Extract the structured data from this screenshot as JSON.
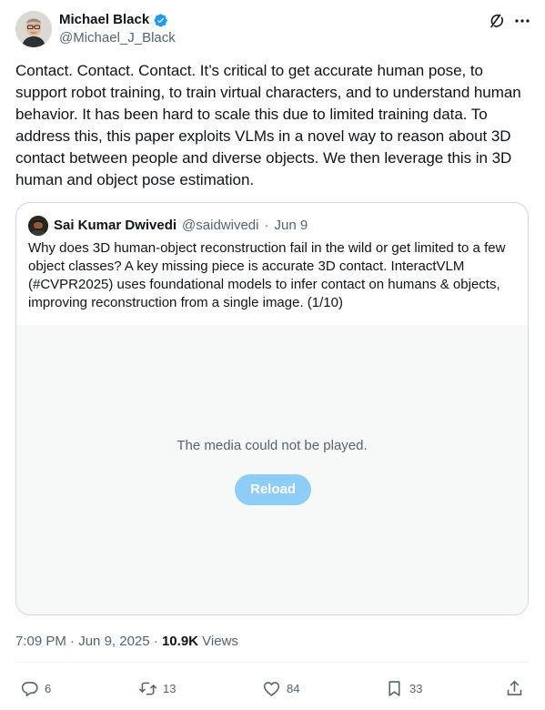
{
  "tweet": {
    "author_name": "Michael Black",
    "author_handle": "@Michael_J_Black",
    "text": "Contact. Contact. Contact. It’s critical to get accurate human pose, to support robot training, to train virtual characters, and to understand human behavior. It has been hard to scale this due to limited training data. To address this, this paper exploits VLMs in a novel way to reason about 3D contact between people and diverse objects. We then leverage this in 3D human and object pose estimation.",
    "time": "7:09 PM",
    "date": "Jun 9, 2025",
    "views_count": "10.9K",
    "views_label": "Views"
  },
  "quote": {
    "author_name": "Sai Kumar Dwivedi",
    "author_handle": "@saidwivedi",
    "date": "Jun 9",
    "text": "Why does 3D human-object reconstruction fail in the wild or get limited to a few object classes? A key missing piece is accurate 3D contact. InteractVLM (#CVPR2025) uses foundational models to infer contact on humans & objects, improving reconstruction from a single image. (1/10)",
    "media_message": "The media could not be played.",
    "reload_label": "Reload"
  },
  "actions": {
    "replies": "6",
    "reposts": "13",
    "likes": "84",
    "bookmarks": "33"
  },
  "icons": {
    "verified": "verified-badge-icon",
    "grok": "grok-icon",
    "more": "more-icon",
    "reply": "reply-icon",
    "repost": "repost-icon",
    "like": "like-icon",
    "bookmark": "bookmark-icon",
    "share": "share-icon"
  },
  "colors": {
    "accent": "#1d9bf0",
    "reload_button": "#8ecdf8",
    "secondary_text": "#536471",
    "border": "#cfd9de"
  }
}
